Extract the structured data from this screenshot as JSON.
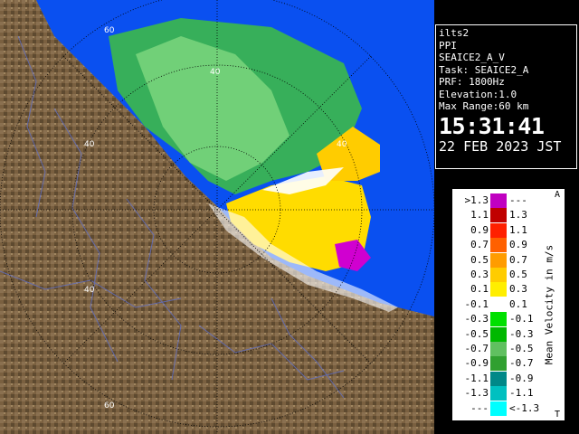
{
  "info": {
    "site": "ilts2",
    "mode": "PPI",
    "product": "SEAICE2_A_V",
    "task": "Task: SEAICE2_A",
    "prf": "PRF: 1800Hz",
    "elevation": "Elevation:1.0",
    "max_range": "Max Range:60 km",
    "time": "15:31:41",
    "date": "22 FEB 2023 JST"
  },
  "legend": {
    "title": "Mean Velocity in m/s",
    "corner_top": "A",
    "corner_bottom": "T",
    "rows": [
      {
        "left": ">1.3",
        "right": "---",
        "color": "#c000c0"
      },
      {
        "left": "1.1",
        "right": "1.3",
        "color": "#c00000"
      },
      {
        "left": "0.9",
        "right": "1.1",
        "color": "#ff2000"
      },
      {
        "left": "0.7",
        "right": "0.9",
        "color": "#ff6000"
      },
      {
        "left": "0.5",
        "right": "0.7",
        "color": "#ff9c00"
      },
      {
        "left": "0.3",
        "right": "0.5",
        "color": "#ffcc00"
      },
      {
        "left": "0.1",
        "right": "0.3",
        "color": "#ffee00"
      },
      {
        "left": "-0.1",
        "right": "0.1",
        "color": "#ffffff"
      },
      {
        "left": "-0.3",
        "right": "-0.1",
        "color": "#00e000"
      },
      {
        "left": "-0.5",
        "right": "-0.3",
        "color": "#00b800"
      },
      {
        "left": "-0.7",
        "right": "-0.5",
        "color": "#60c060"
      },
      {
        "left": "-0.9",
        "right": "-0.7",
        "color": "#30a030"
      },
      {
        "left": "-1.1",
        "right": "-0.9",
        "color": "#008888"
      },
      {
        "left": "-1.3",
        "right": "-1.1",
        "color": "#00c0c0"
      },
      {
        "left": "---",
        "right": "<-1.3",
        "color": "#00ffff"
      }
    ]
  },
  "map": {
    "range_labels": [
      "60",
      "40",
      "40",
      "40",
      "40",
      "60"
    ],
    "colors": {
      "sea": "#0a50f0",
      "land": "#7a6040",
      "ring": "#000000"
    }
  }
}
